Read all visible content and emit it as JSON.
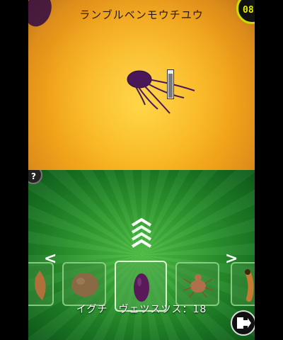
{
  "top": {
    "species_name": "ランブルベンモウチユウ",
    "counter": "08",
    "zoom_level": 0.9
  },
  "bottom": {
    "help_label": "?",
    "label": "イグチ　ヴェツスツス：18",
    "scroll_left_label": "<",
    "scroll_right_label": ">",
    "specimens": [
      {
        "name": "specimen-leaf",
        "color": "#b0703a"
      },
      {
        "name": "specimen-brown-blob",
        "color": "#8a6a45"
      },
      {
        "name": "specimen-purple-egg",
        "color": "#5a1a5a"
      },
      {
        "name": "specimen-mite",
        "color": "#b0704a"
      },
      {
        "name": "specimen-larva",
        "color": "#c87a30"
      }
    ],
    "selected_index": 2
  },
  "colors": {
    "top_bg": "#f9b51f",
    "bottom_bg": "#2f9a30",
    "badge_ring": "#c8e000"
  }
}
